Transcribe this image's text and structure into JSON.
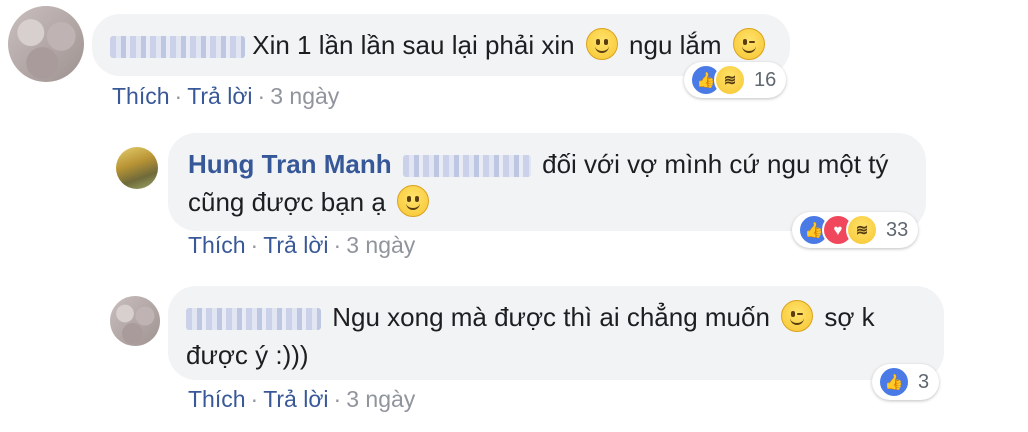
{
  "comments": [
    {
      "text": "Xin 1 lần lần sau lại phải xin",
      "text2": "ngu lắm",
      "meta": {
        "like": "Thích",
        "reply": "Trả lời",
        "time": "3 ngày"
      },
      "reactions": {
        "count": "16"
      }
    },
    {
      "author": "Hung Tran Manh",
      "text_line1": "đối với vợ mình cứ ngu một tý",
      "text_line2": "cũng được bạn ạ",
      "meta": {
        "like": "Thích",
        "reply": "Trả lời",
        "time": "3 ngày"
      },
      "reactions": {
        "count": "33"
      }
    },
    {
      "text_line1": "Ngu xong mà được thì ai chẳng muốn",
      "text_line1b": "sợ k",
      "text_line2": "được ý :)))",
      "meta": {
        "like": "Thích",
        "reply": "Trả lời",
        "time": "3 ngày"
      },
      "reactions": {
        "count": "3"
      }
    }
  ],
  "meta_separator": "·",
  "icons": {
    "like": "like-icon",
    "love": "love-icon",
    "haha": "haha-icon",
    "smile": "smile-emoji-icon",
    "wink": "wink-emoji-icon"
  }
}
